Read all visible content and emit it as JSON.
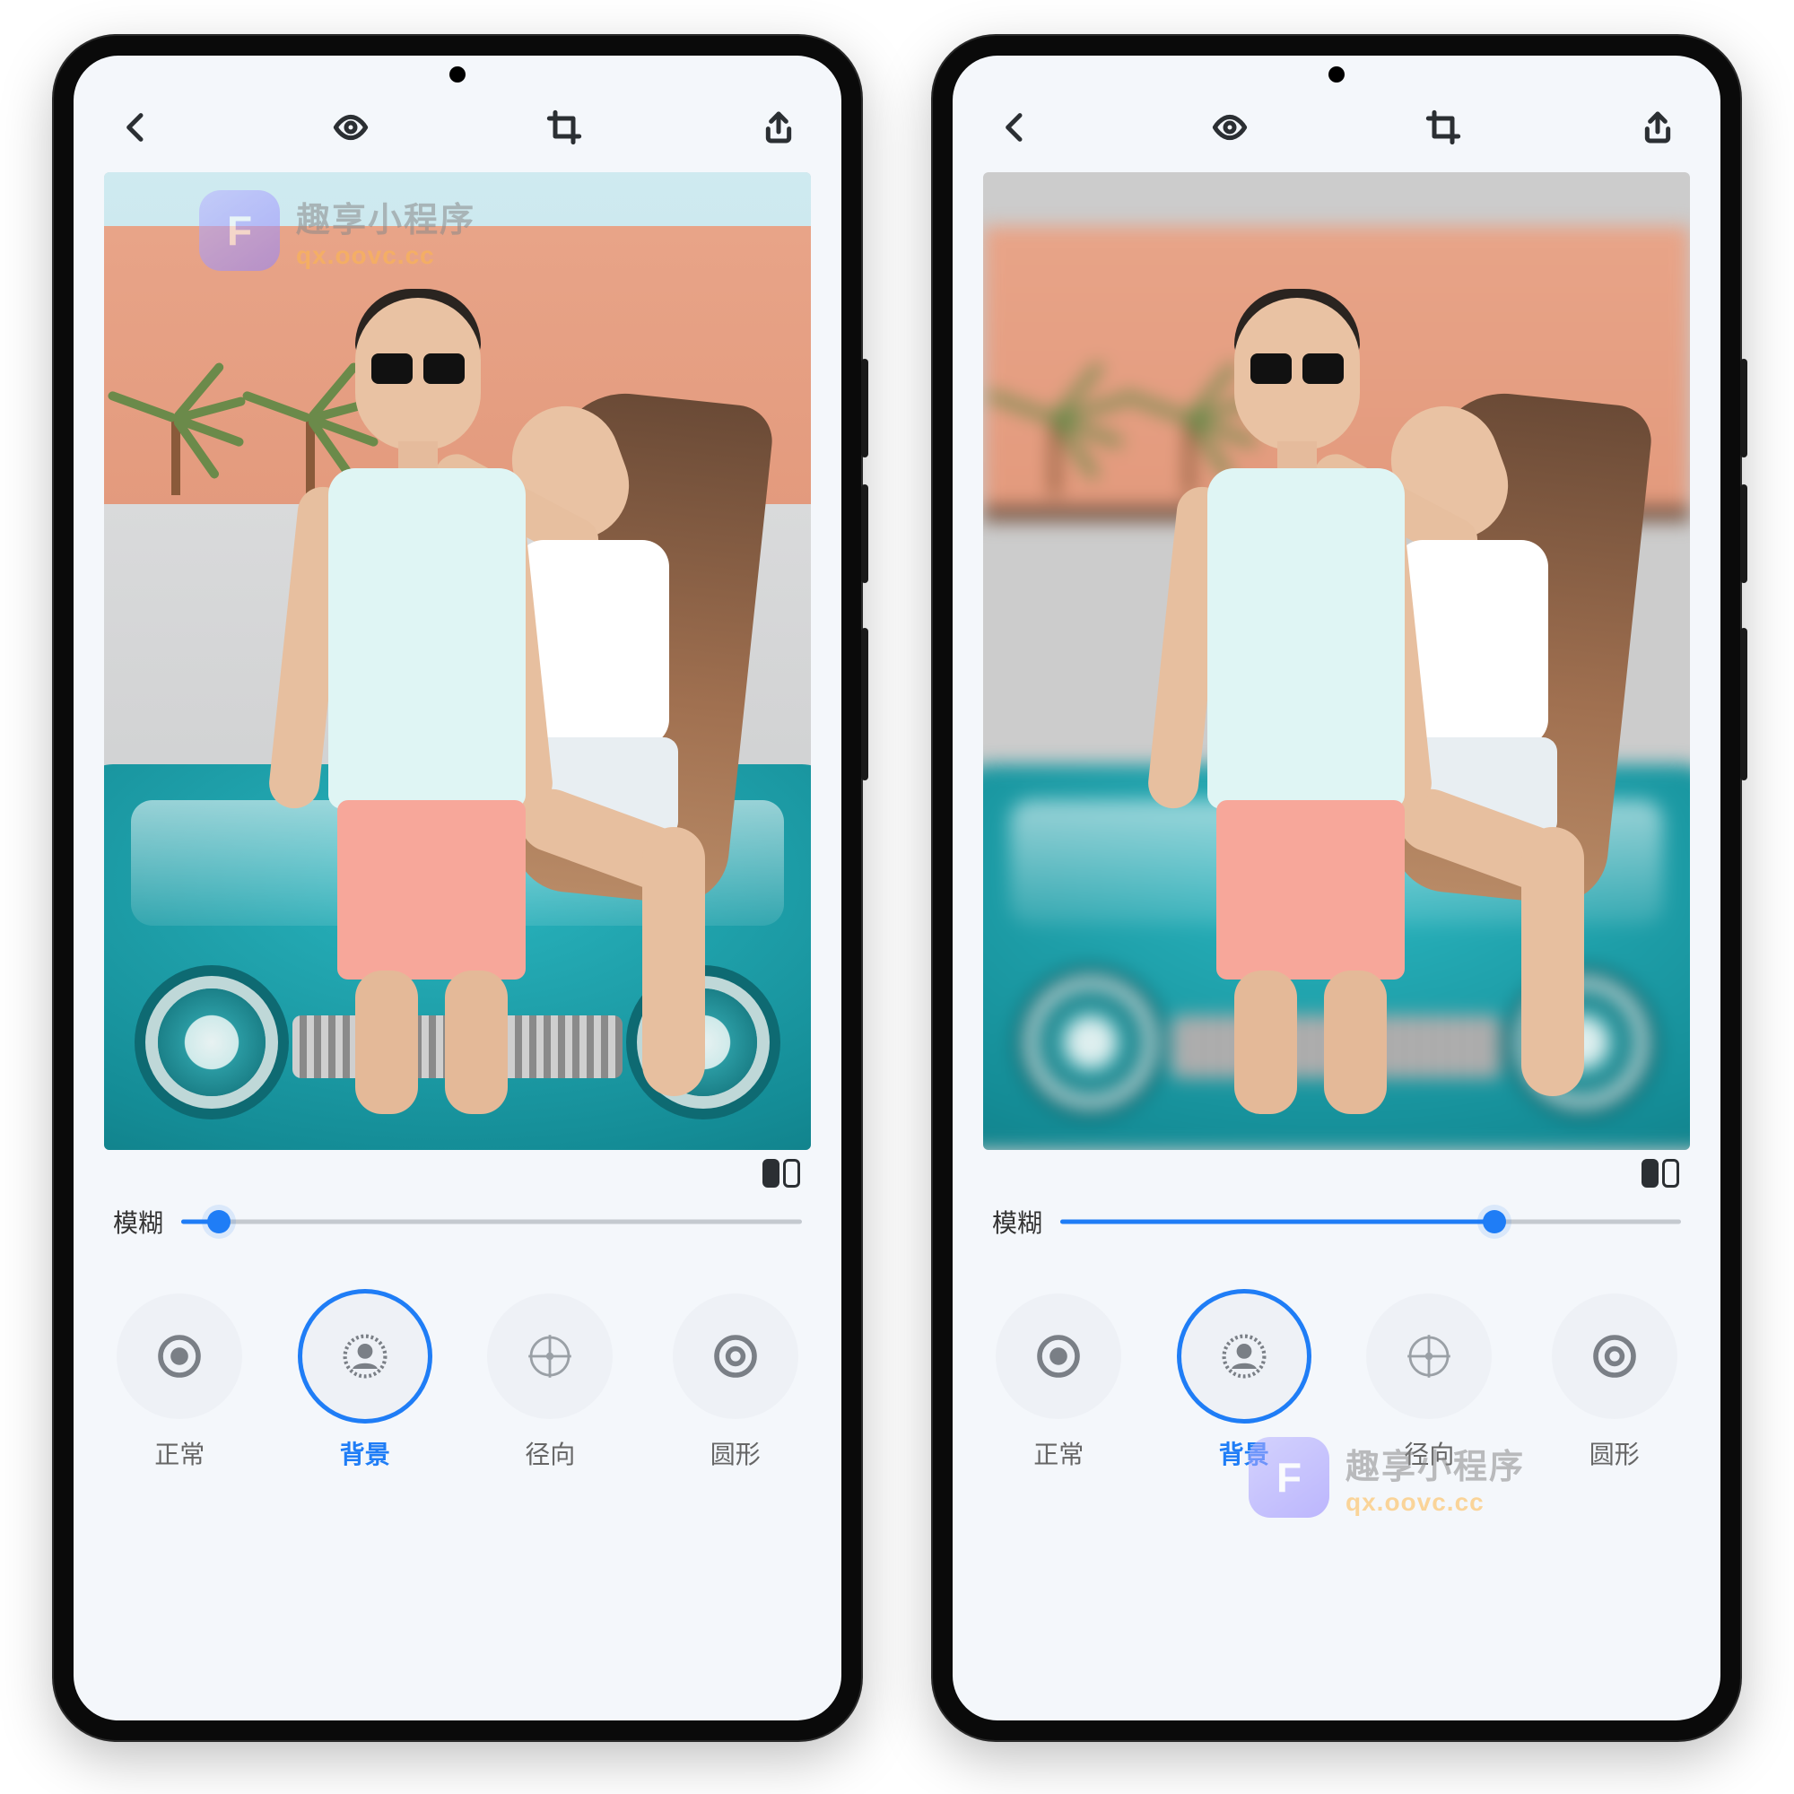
{
  "watermark": {
    "badge": "F",
    "line1": "趣享小程序",
    "line2": "qx.oovc.cc"
  },
  "topbar_icons": [
    "back-icon",
    "eye-icon",
    "crop-icon",
    "share-icon"
  ],
  "slider": {
    "label": "模糊"
  },
  "options": [
    {
      "key": "normal",
      "label": "正常"
    },
    {
      "key": "background",
      "label": "背景"
    },
    {
      "key": "radial",
      "label": "径向"
    },
    {
      "key": "circle",
      "label": "圆形"
    }
  ],
  "phones": [
    {
      "sliderPercent": 6,
      "activeIndex": 1,
      "blurBackground": false,
      "watermarkPos": "top"
    },
    {
      "sliderPercent": 70,
      "activeIndex": 1,
      "blurBackground": true,
      "watermarkPos": "bot"
    }
  ]
}
